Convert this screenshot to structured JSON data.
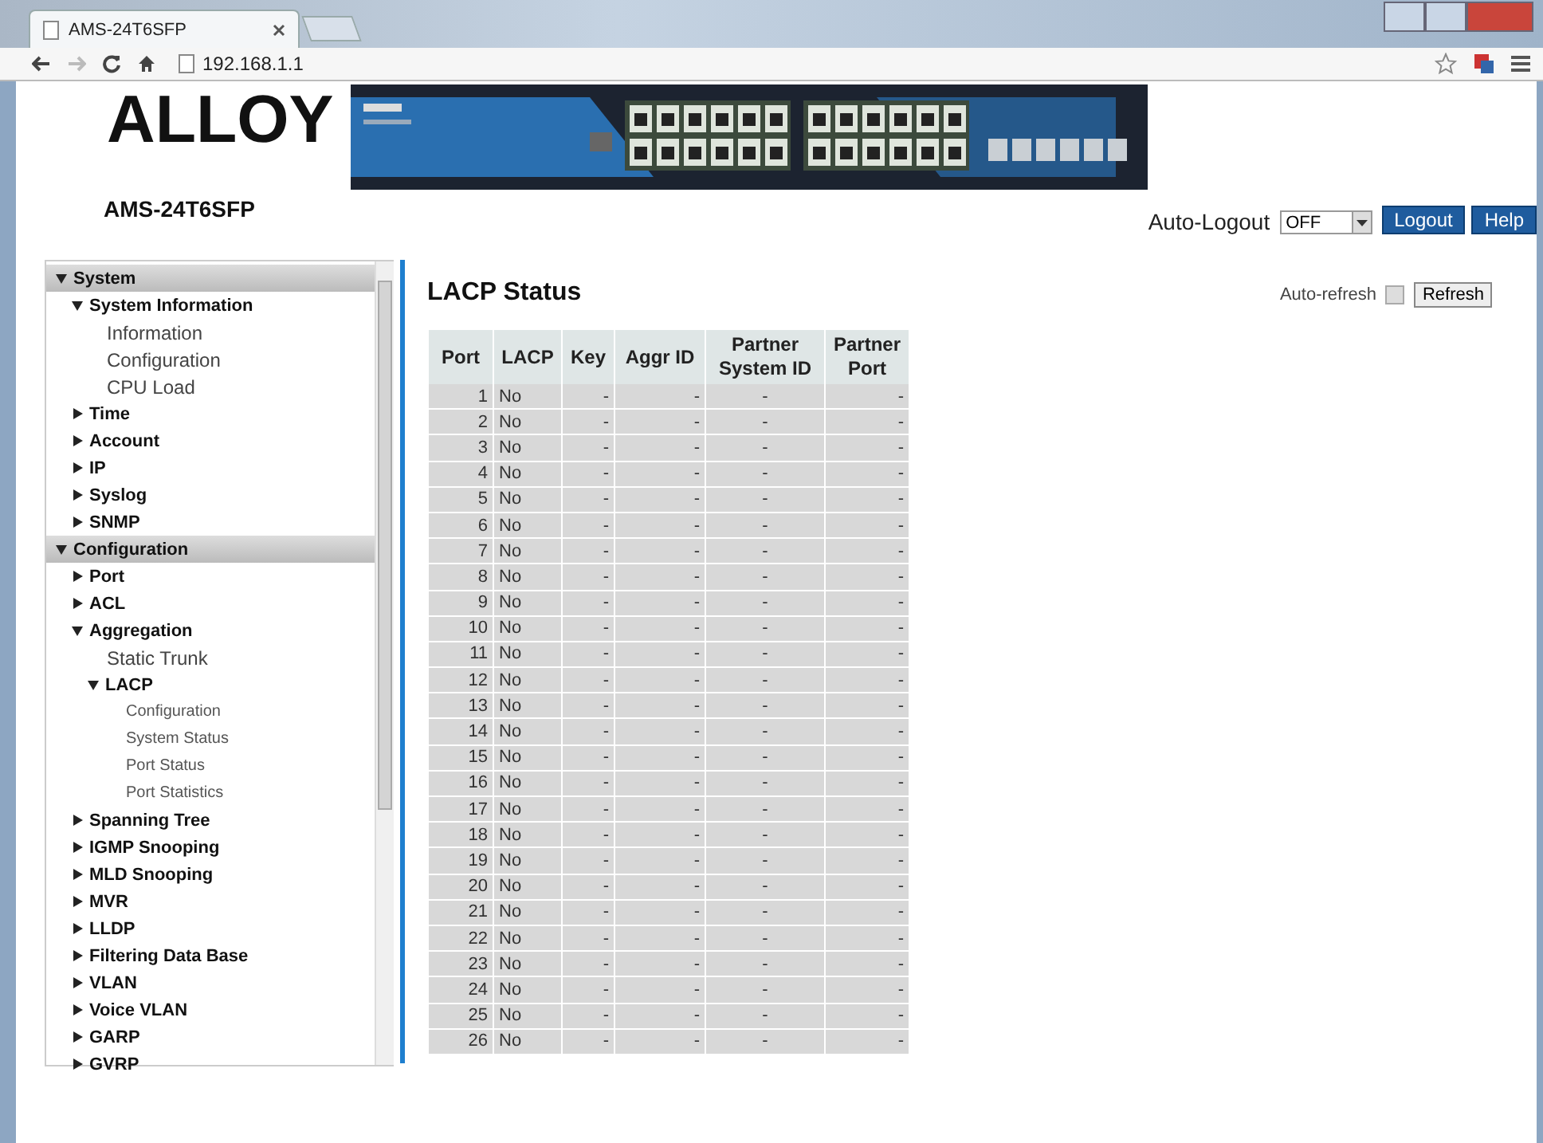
{
  "browser": {
    "tab_title": "AMS-24T6SFP",
    "address": "192.168.1.1"
  },
  "header": {
    "logo": "ALLOY",
    "model": "AMS-24T6SFP",
    "auto_logout_label": "Auto-Logout",
    "auto_logout_value": "OFF",
    "buttons": [
      "Logout",
      "Help"
    ]
  },
  "sidebar": {
    "items": [
      {
        "label": "System",
        "expanded": true,
        "children": [
          {
            "label": "System Information",
            "expanded": true,
            "children": [
              {
                "label": "Information"
              },
              {
                "label": "Configuration"
              },
              {
                "label": "CPU Load"
              }
            ]
          },
          {
            "label": "Time",
            "expanded": false
          },
          {
            "label": "Account",
            "expanded": false
          },
          {
            "label": "IP",
            "expanded": false
          },
          {
            "label": "Syslog",
            "expanded": false
          },
          {
            "label": "SNMP",
            "expanded": false
          }
        ]
      },
      {
        "label": "Configuration",
        "expanded": true,
        "children": [
          {
            "label": "Port",
            "expanded": false
          },
          {
            "label": "ACL",
            "expanded": false
          },
          {
            "label": "Aggregation",
            "expanded": true,
            "children": [
              {
                "label": "Static Trunk"
              },
              {
                "label": "LACP",
                "expanded": true,
                "children": [
                  {
                    "label": "Configuration"
                  },
                  {
                    "label": "System Status"
                  },
                  {
                    "label": "Port Status"
                  },
                  {
                    "label": "Port Statistics"
                  }
                ]
              }
            ]
          },
          {
            "label": "Spanning Tree",
            "expanded": false
          },
          {
            "label": "IGMP Snooping",
            "expanded": false
          },
          {
            "label": "MLD Snooping",
            "expanded": false
          },
          {
            "label": "MVR",
            "expanded": false
          },
          {
            "label": "LLDP",
            "expanded": false
          },
          {
            "label": "Filtering Data Base",
            "expanded": false
          },
          {
            "label": "VLAN",
            "expanded": false
          },
          {
            "label": "Voice VLAN",
            "expanded": false
          },
          {
            "label": "GARP",
            "expanded": false
          },
          {
            "label": "GVRP",
            "expanded": false
          }
        ]
      }
    ]
  },
  "main": {
    "title": "LACP Status",
    "auto_refresh_label": "Auto-refresh",
    "auto_refresh_checked": false,
    "refresh_button": "Refresh",
    "table": {
      "columns": [
        "Port",
        "LACP",
        "Key",
        "Aggr ID",
        "Partner System ID",
        "Partner Port"
      ],
      "rows": [
        [
          "1",
          "No",
          "-",
          "-",
          "-",
          "-"
        ],
        [
          "2",
          "No",
          "-",
          "-",
          "-",
          "-"
        ],
        [
          "3",
          "No",
          "-",
          "-",
          "-",
          "-"
        ],
        [
          "4",
          "No",
          "-",
          "-",
          "-",
          "-"
        ],
        [
          "5",
          "No",
          "-",
          "-",
          "-",
          "-"
        ],
        [
          "6",
          "No",
          "-",
          "-",
          "-",
          "-"
        ],
        [
          "7",
          "No",
          "-",
          "-",
          "-",
          "-"
        ],
        [
          "8",
          "No",
          "-",
          "-",
          "-",
          "-"
        ],
        [
          "9",
          "No",
          "-",
          "-",
          "-",
          "-"
        ],
        [
          "10",
          "No",
          "-",
          "-",
          "-",
          "-"
        ],
        [
          "11",
          "No",
          "-",
          "-",
          "-",
          "-"
        ],
        [
          "12",
          "No",
          "-",
          "-",
          "-",
          "-"
        ],
        [
          "13",
          "No",
          "-",
          "-",
          "-",
          "-"
        ],
        [
          "14",
          "No",
          "-",
          "-",
          "-",
          "-"
        ],
        [
          "15",
          "No",
          "-",
          "-",
          "-",
          "-"
        ],
        [
          "16",
          "No",
          "-",
          "-",
          "-",
          "-"
        ],
        [
          "17",
          "No",
          "-",
          "-",
          "-",
          "-"
        ],
        [
          "18",
          "No",
          "-",
          "-",
          "-",
          "-"
        ],
        [
          "19",
          "No",
          "-",
          "-",
          "-",
          "-"
        ],
        [
          "20",
          "No",
          "-",
          "-",
          "-",
          "-"
        ],
        [
          "21",
          "No",
          "-",
          "-",
          "-",
          "-"
        ],
        [
          "22",
          "No",
          "-",
          "-",
          "-",
          "-"
        ],
        [
          "23",
          "No",
          "-",
          "-",
          "-",
          "-"
        ],
        [
          "24",
          "No",
          "-",
          "-",
          "-",
          "-"
        ],
        [
          "25",
          "No",
          "-",
          "-",
          "-",
          "-"
        ],
        [
          "26",
          "No",
          "-",
          "-",
          "-",
          "-"
        ]
      ]
    }
  }
}
